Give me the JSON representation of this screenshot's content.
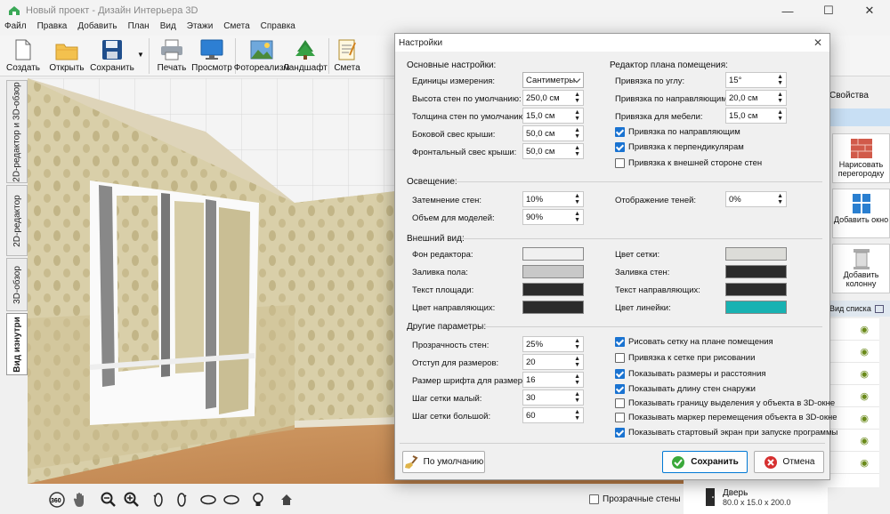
{
  "app": {
    "title": "Новый проект - Дизайн Интерьера 3D"
  },
  "window_controls": {
    "minimize": "—",
    "maximize": "☐",
    "close": "✕"
  },
  "menu": [
    "Файл",
    "Правка",
    "Добавить",
    "План",
    "Вид",
    "Этажи",
    "Смета",
    "Справка"
  ],
  "toolbar": {
    "create": "Создать",
    "open": "Открыть",
    "save": "Сохранить",
    "print": "Печать",
    "preview": "Просмотр",
    "photorealism": "Фотореализм",
    "landscape": "Ландшафт",
    "estimate": "Смета"
  },
  "side_tabs": [
    "2D-редактор и 3D-обзор",
    "2D-редактор",
    "3D-обзор",
    "Вид изнутри"
  ],
  "view_bottom": {
    "transparent_walls": "Прозрачные стены",
    "zoom_badge": "360"
  },
  "right_panel": {
    "tab": "Свойства",
    "draw_partition": "Нарисовать перегородку",
    "add_window": "Добавить окно",
    "add_column": "Добавить колонну",
    "list_view": "Вид списка",
    "door_name": "Дверь",
    "door_size": "80.0 x 15.0 x 200.0"
  },
  "dialog": {
    "title": "Настройки",
    "close": "✕",
    "basic": {
      "title": "Основные настройки:",
      "units_label": "Единицы измерения:",
      "units_value": "Сантиметры",
      "wall_height_label": "Высота стен по умолчанию:",
      "wall_height": "250,0 см",
      "wall_thickness_label": "Толщина стен по умолчанию:",
      "wall_thickness": "15,0 см",
      "side_overhang_label": "Боковой свес крыши:",
      "side_overhang": "50,0 см",
      "front_overhang_label": "Фронтальный свес крыши:",
      "front_overhang": "50,0 см"
    },
    "plan_editor": {
      "title": "Редактор плана помещения:",
      "angle_snap_label": "Привязка по углу:",
      "angle_snap": "15°",
      "guide_snap_label": "Привязка по направляющим:",
      "guide_snap": "20,0 см",
      "furniture_snap_label": "Привязка для мебели:",
      "furniture_snap": "15,0 см",
      "cb_guides": "Привязка по направляющим",
      "cb_perpendicular": "Привязка к перпендикулярам",
      "cb_outer_wall": "Привязка к внешней стороне стен"
    },
    "lighting": {
      "title": "Освещение:",
      "wall_shading_label": "Затемнение стен:",
      "wall_shading": "10%",
      "model_volume_label": "Объем для моделей:",
      "model_volume": "90%",
      "shadows_label": "Отображение теней:",
      "shadows": "0%"
    },
    "appearance": {
      "title": "Внешний вид:",
      "editor_bg": "Фон редактора:",
      "floor_fill": "Заливка пола:",
      "area_text": "Текст площади:",
      "guide_color": "Цвет направляющих:",
      "grid_color": "Цвет сетки:",
      "wall_fill": "Заливка стен:",
      "guide_text": "Текст направляющих:",
      "ruler_color": "Цвет линейки:",
      "colors": {
        "editor_bg": "#f0f0f0",
        "floor_fill": "#c8c8c8",
        "area_text": "#2b2b2b",
        "guide_color": "#2b2b2b",
        "grid_color": "#dcdcd8",
        "wall_fill": "#2b2b2b",
        "guide_text": "#2b2b2b",
        "ruler_color": "#18b2b2"
      }
    },
    "other": {
      "title": "Другие параметры:",
      "wall_transparency_label": "Прозрачность стен:",
      "wall_transparency": "25%",
      "dim_offset_label": "Отступ для размеров:",
      "dim_offset": "20",
      "dim_font_label": "Размер шрифта для размеров:",
      "dim_font": "16",
      "grid_small_label": "Шаг сетки малый:",
      "grid_small": "30",
      "grid_large_label": "Шаг сетки большой:",
      "grid_large": "60",
      "checks": [
        {
          "label": "Рисовать сетку на плане помещения",
          "checked": true
        },
        {
          "label": "Привязка к сетке при рисовании",
          "checked": false
        },
        {
          "label": "Показывать размеры и расстояния",
          "checked": true
        },
        {
          "label": "Показывать длину стен снаружи",
          "checked": true
        },
        {
          "label": "Показывать границу выделения у объекта в 3D-окне",
          "checked": false
        },
        {
          "label": "Показывать маркер перемещения объекта в 3D-окне",
          "checked": false
        },
        {
          "label": "Показывать стартовый экран при запуске программы",
          "checked": true
        }
      ]
    },
    "buttons": {
      "defaults": "По умолчанию",
      "save": "Сохранить",
      "cancel": "Отмена"
    }
  }
}
